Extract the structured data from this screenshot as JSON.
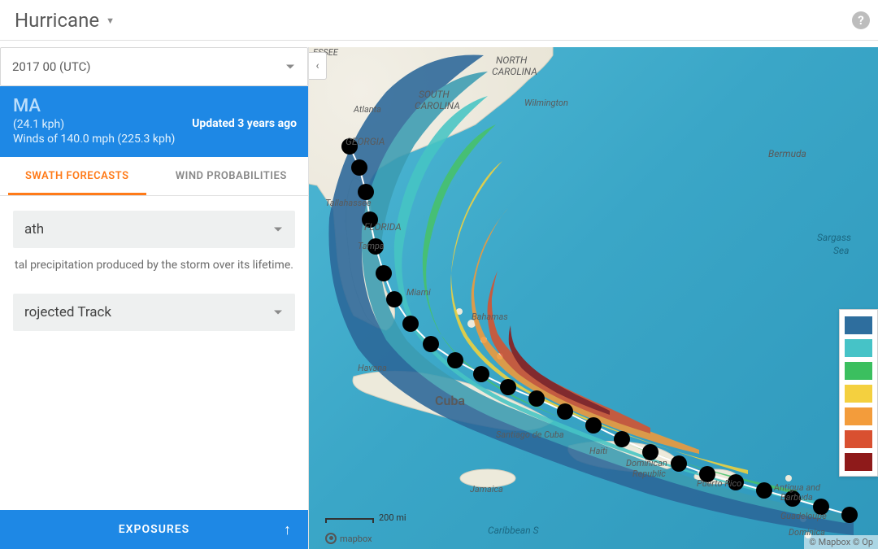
{
  "topbar": {
    "title": "Hurricane"
  },
  "sidebar": {
    "date_selector": "2017 00 (UTC)",
    "storm": {
      "name": "MA",
      "speed": "(24.1 kph)",
      "winds": "Winds of 140.0 mph (225.3 kph)",
      "updated": "Updated 3 years ago"
    },
    "tabs": {
      "swath": "SWATH FORECASTS",
      "wind": "WIND PROBABILITIES"
    },
    "swath_select": "ath",
    "description": "tal precipitation produced by the storm over its lifetime.",
    "track_select": "rojected Track",
    "exposures_label": "EXPOSURES"
  },
  "map": {
    "scale_label": "200 mi",
    "mapbox_logo": "mapbox",
    "attribution": "© Mapbox © Op",
    "labels": {
      "north_carolina": "NORTH\nCAROLINA",
      "south_carolina": "SOUTH\nCAROLINA",
      "wilmington": "Wilmington",
      "atlanta": "Atlanta",
      "georgia": "GEORGIA",
      "tallahassee": "Tallahassee",
      "florida": "FLORIDA",
      "tampa": "Tampa",
      "miami": "Miami",
      "bermuda": "Bermuda",
      "bahamas": "Bahamas",
      "havana": "Havana",
      "cuba": "Cuba",
      "santiago": "Santiago de Cuba",
      "jamaica": "Jamaica",
      "haiti": "Haiti",
      "dominican": "Dominican\nRepublic",
      "puerto_rico": "Puerto Rico",
      "antigua": "Antigua and\nBarbuda",
      "guadeloupe": "Guadeloupe",
      "dominica": "Dominica",
      "caribbean": "Caribbean S",
      "sargasso": "Sargass\nSea",
      "essee": "ESSEE"
    },
    "legend_colors": [
      "#2e6e9e",
      "#46c3c7",
      "#3bbf5f",
      "#f4d03f",
      "#f39c3b",
      "#d95030",
      "#8e1a1a"
    ]
  }
}
